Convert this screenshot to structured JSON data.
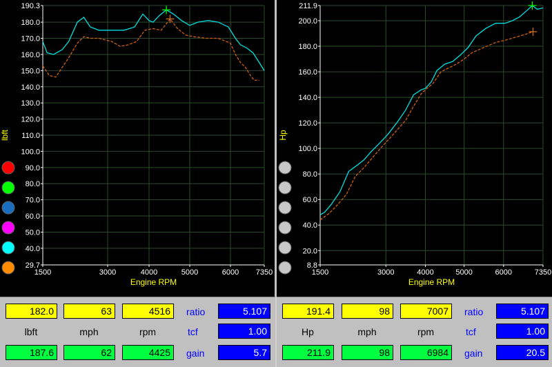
{
  "colors": {
    "measured_curve": "#00e0e0",
    "reference_curve": "#d06010",
    "axis_text": "#ffffff",
    "axis_label": "#ffff00",
    "grid": "#2e4a2e"
  },
  "swatches_left": [
    {
      "color": "#ff0000",
      "name": "red"
    },
    {
      "color": "#00ff00",
      "name": "green"
    },
    {
      "color": "#1a6ec0",
      "name": "blue"
    },
    {
      "color": "#ff00ff",
      "name": "magenta"
    },
    {
      "color": "#00ffff",
      "name": "cyan"
    },
    {
      "color": "#ff8c00",
      "name": "orange"
    }
  ],
  "swatches_right": [
    {
      "color": "#c8c8c8"
    },
    {
      "color": "#c8c8c8"
    },
    {
      "color": "#c8c8c8"
    },
    {
      "color": "#c8c8c8"
    },
    {
      "color": "#c8c8c8"
    },
    {
      "color": "#c8c8c8"
    }
  ],
  "chart_data": [
    {
      "type": "line",
      "xlabel": "Engine RPM",
      "ylabel": "lbft",
      "xlim": [
        1500,
        7350
      ],
      "ylim": [
        29.7,
        190.3
      ],
      "x_ticks": [
        "1500",
        "3000",
        "4000",
        "5000",
        "6000",
        "7350"
      ],
      "x_tick_values": [
        1500,
        3000,
        4000,
        5000,
        6000,
        7350
      ],
      "y_ticks": [
        "29.7",
        "40.0",
        "50.0",
        "60.0",
        "70.0",
        "80.0",
        "90.0",
        "100.0",
        "110.0",
        "120.0",
        "130.0",
        "140.0",
        "150.0",
        "160.0",
        "170.0",
        "180.0",
        "190.3"
      ],
      "y_tick_values": [
        29.7,
        40,
        50,
        60,
        70,
        80,
        90,
        100,
        110,
        120,
        130,
        140,
        150,
        160,
        170,
        180,
        190.3
      ],
      "grid": true,
      "series": [
        {
          "x": [
            1500,
            1600,
            1750,
            1950,
            2100,
            2300,
            2450,
            2600,
            2800,
            3100,
            3400,
            3650,
            3850,
            4000,
            4100,
            4250,
            4425,
            4600,
            4800,
            5000,
            5200,
            5450,
            5700,
            5950,
            6200,
            6400,
            6650,
            6900,
            7150,
            7350
          ],
          "y": [
            168,
            161,
            160,
            163,
            168,
            180,
            183,
            177,
            175,
            175,
            175,
            177,
            185,
            181,
            180,
            184,
            187.6,
            185,
            181,
            178,
            180,
            181,
            180,
            177,
            170,
            166,
            164,
            161,
            155,
            150
          ]
        },
        {
          "x": [
            1500,
            1650,
            1800,
            1950,
            2100,
            2300,
            2450,
            2600,
            2800,
            3100,
            3300,
            3500,
            3700,
            3900,
            4100,
            4300,
            4516,
            4700,
            4900,
            5100,
            5400,
            5700,
            6000,
            6200,
            6400,
            6600,
            6800,
            6950,
            7150
          ],
          "y": [
            153,
            147,
            146,
            152,
            158,
            167,
            171,
            170,
            170,
            168,
            165,
            166,
            168,
            175,
            176,
            175,
            182,
            176,
            172,
            171,
            170,
            170,
            167,
            160,
            155,
            152,
            147,
            144,
            144
          ]
        }
      ],
      "markers": [
        {
          "x": 4425,
          "y": 187.6,
          "color": "#00ff00"
        },
        {
          "x": 4516,
          "y": 182.0,
          "color": "#d07010"
        }
      ]
    },
    {
      "type": "line",
      "xlabel": "Engine RPM",
      "ylabel": "Hp",
      "xlim": [
        1500,
        7350
      ],
      "ylim": [
        8.8,
        211.9
      ],
      "x_ticks": [
        "1500",
        "3000",
        "4000",
        "5000",
        "6000",
        "7350"
      ],
      "x_tick_values": [
        1500,
        3000,
        4000,
        5000,
        6000,
        7350
      ],
      "y_ticks": [
        "8.8",
        "20.0",
        "40.0",
        "60.0",
        "80.0",
        "100.0",
        "120.0",
        "140.0",
        "160.0",
        "180.0",
        "200.0",
        "211.9"
      ],
      "y_tick_values": [
        8.8,
        20,
        40,
        60,
        80,
        100,
        120,
        140,
        160,
        180,
        200,
        211.9
      ],
      "grid": true,
      "series": [
        {
          "x": [
            1500,
            1600,
            1750,
            1950,
            2150,
            2350,
            2500,
            2650,
            2850,
            3050,
            3300,
            3500,
            3700,
            3900,
            4000,
            4150,
            4300,
            4500,
            4700,
            4900,
            5100,
            5300,
            5550,
            5800,
            6050,
            6300,
            6550,
            6800,
            6984,
            7150,
            7350
          ],
          "y": [
            48,
            50,
            56,
            66,
            82,
            87,
            91,
            97,
            104,
            111,
            121,
            130,
            142,
            146,
            147,
            152,
            161,
            166,
            168,
            173,
            179,
            188,
            194,
            198,
            198,
            200,
            203,
            208,
            211.9,
            209,
            210
          ]
        },
        {
          "x": [
            1500,
            1700,
            1900,
            2100,
            2300,
            2500,
            2700,
            2900,
            3100,
            3300,
            3500,
            3700,
            3900,
            4000,
            4200,
            4400,
            4600,
            4800,
            5000,
            5200,
            5500,
            5800,
            6100,
            6400,
            6700,
            7007
          ],
          "y": [
            44,
            49,
            56,
            64,
            78,
            85,
            93,
            101,
            108,
            115,
            122,
            133,
            143,
            146,
            151,
            160,
            163,
            166,
            170,
            175,
            179,
            183,
            185,
            187,
            189,
            191.4
          ]
        }
      ],
      "markers": [
        {
          "x": 6984,
          "y": 211.9,
          "color": "#00ff00"
        },
        {
          "x": 7007,
          "y": 191.4,
          "color": "#d07010"
        }
      ]
    }
  ],
  "readouts_left": {
    "ref_torque": "182.0",
    "ref_mph": "63",
    "ref_rpm": "4516",
    "cur_torque": "187.6",
    "cur_mph": "62",
    "cur_rpm": "4425",
    "unit_label": "lbft",
    "mph_label": "mph",
    "rpm_label": "rpm",
    "ratio_label": "ratio",
    "ratio_value": "5.107",
    "tcf_label": "tcf",
    "tcf_value": "1.00",
    "gain_label": "gain",
    "gain_value": "5.7"
  },
  "readouts_right": {
    "ref_power": "191.4",
    "ref_mph": "98",
    "ref_rpm": "7007",
    "cur_power": "211.9",
    "cur_mph": "98",
    "cur_rpm": "6984",
    "unit_label": "Hp",
    "mph_label": "mph",
    "rpm_label": "rpm",
    "ratio_label": "ratio",
    "ratio_value": "5.107",
    "tcf_label": "tcf",
    "tcf_value": "1.00",
    "gain_label": "gain",
    "gain_value": "20.5"
  }
}
